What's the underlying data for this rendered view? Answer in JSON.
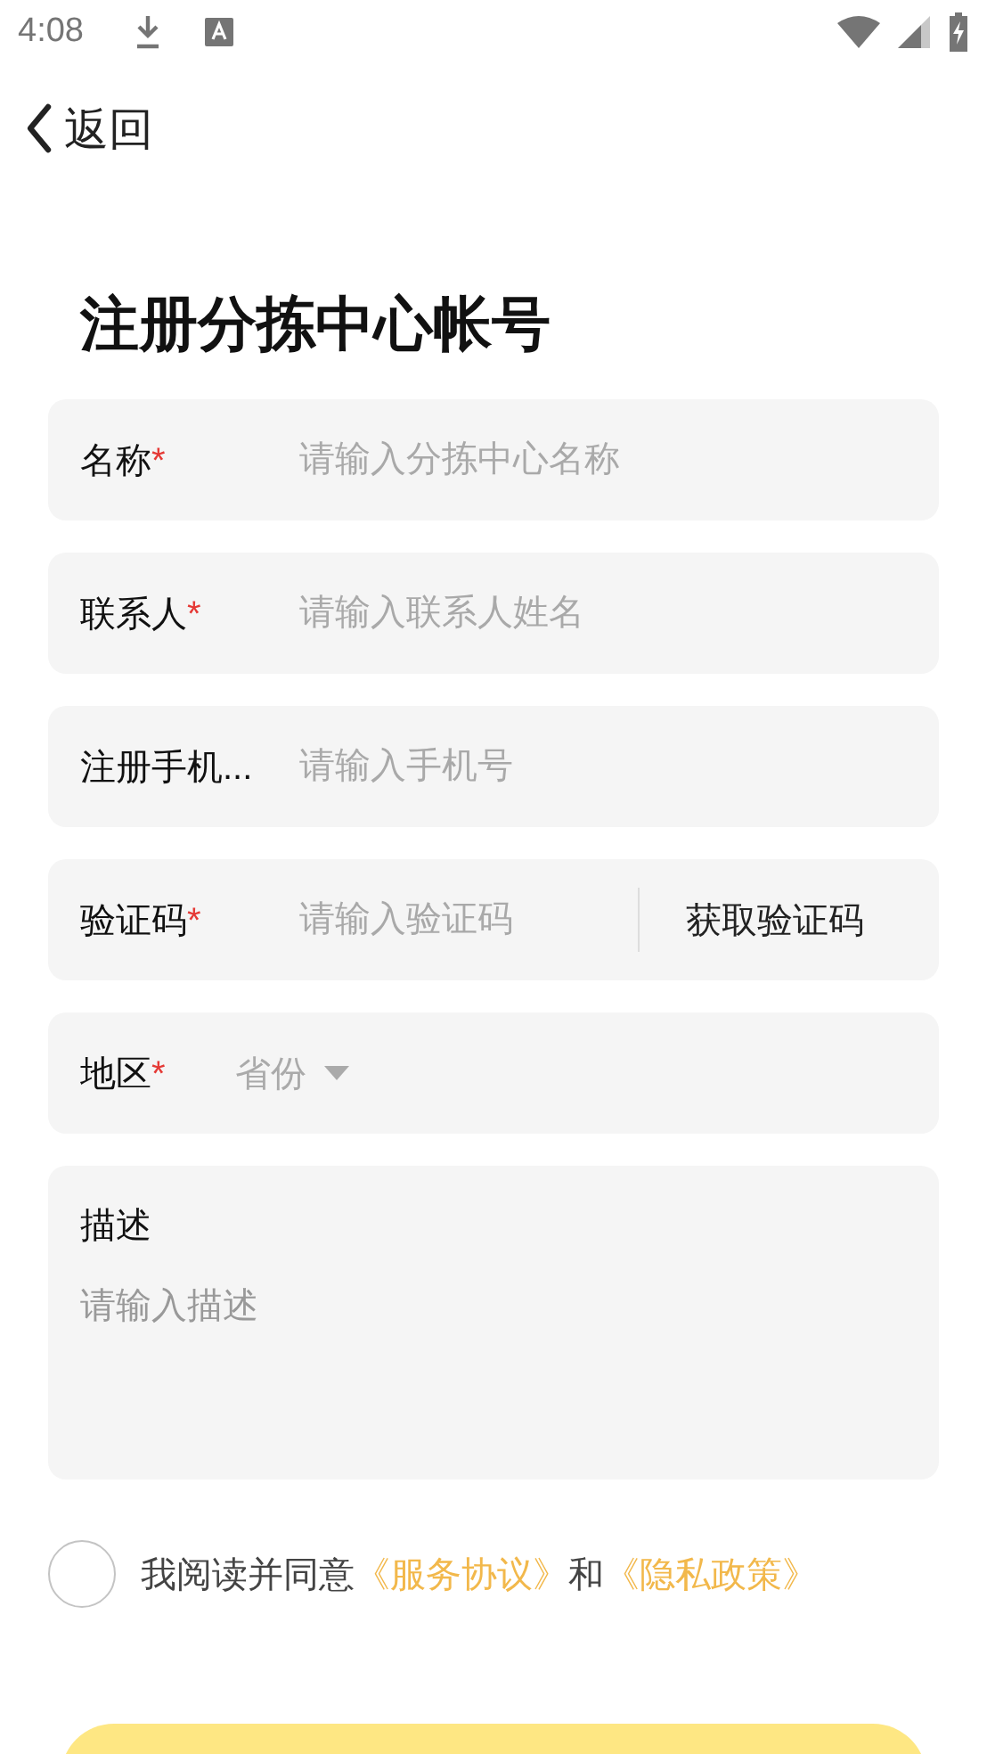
{
  "status_bar": {
    "time": "4:08"
  },
  "nav": {
    "back_label": "返回"
  },
  "title": "注册分拣中心帐号",
  "fields": [
    {
      "kind": "text",
      "label": "名称",
      "required_mark": "*",
      "placeholder": "请输入分拣中心名称"
    },
    {
      "kind": "text",
      "label": "联系人",
      "required_mark": "*",
      "placeholder": "请输入联系人姓名"
    },
    {
      "kind": "text",
      "label": "注册手机...",
      "placeholder": "请输入手机号"
    },
    {
      "kind": "code",
      "label": "验证码",
      "required_mark": "*",
      "placeholder": "请输入验证码",
      "action": "获取验证码"
    },
    {
      "kind": "select",
      "label": "地区",
      "required_mark": "*",
      "placeholder": "省份"
    },
    {
      "kind": "textarea",
      "label": "描述",
      "placeholder": "请输入描述"
    }
  ],
  "agreement": {
    "checked": false,
    "parts": [
      {
        "kind": "text",
        "text": "我阅读并同意"
      },
      {
        "kind": "link",
        "text": "《服务协议》"
      },
      {
        "kind": "text",
        "text": "和"
      },
      {
        "kind": "link",
        "text": "《隐私政策》"
      }
    ]
  }
}
